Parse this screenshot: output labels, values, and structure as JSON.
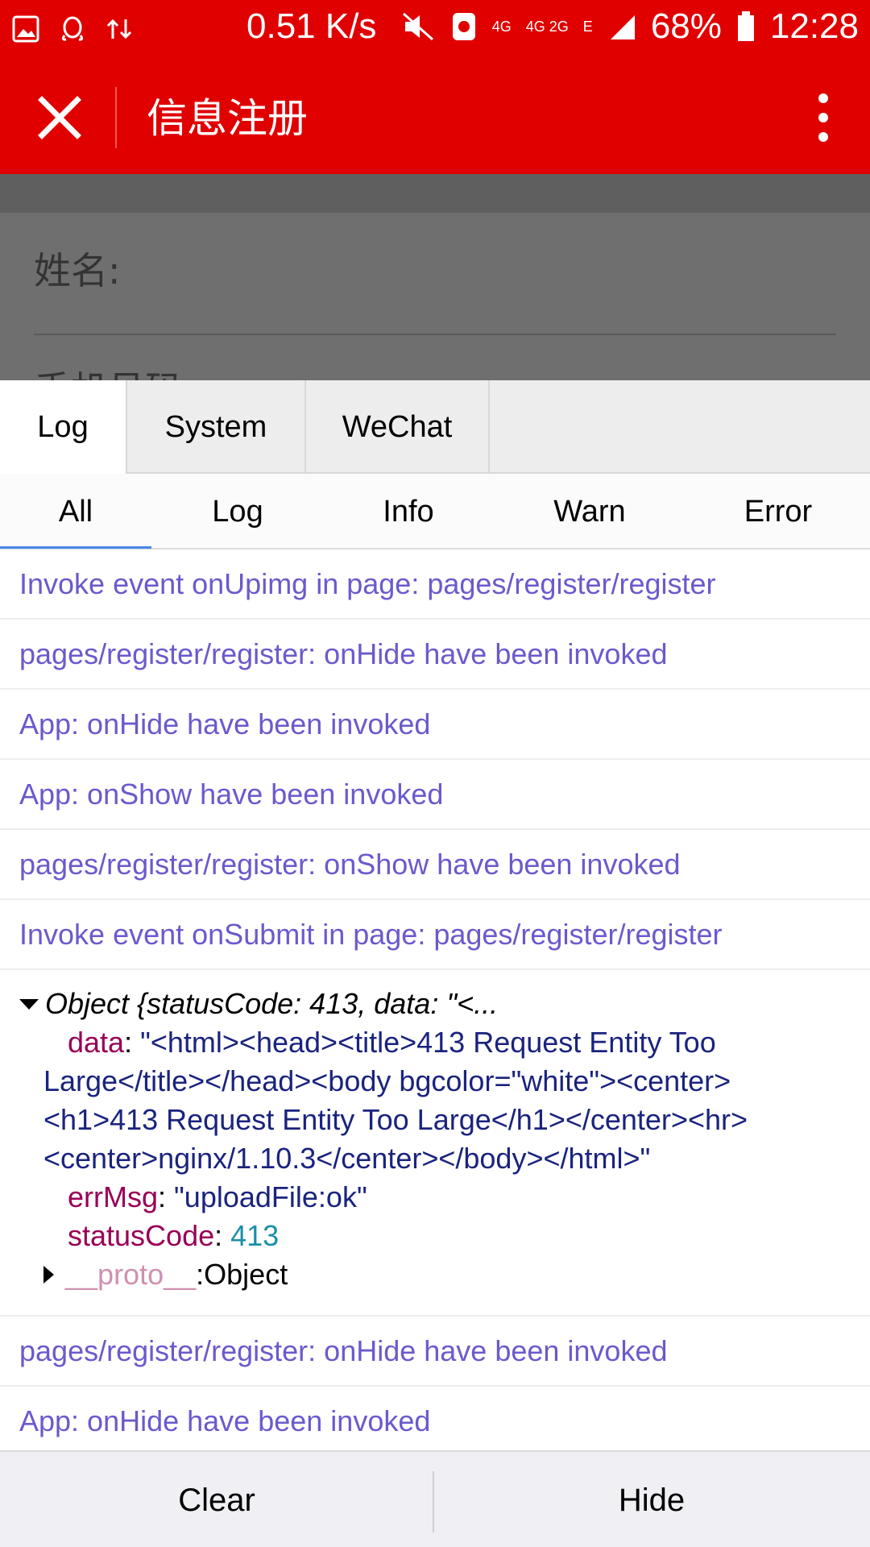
{
  "status_bar": {
    "speed": "0.51 K/s",
    "net_a": "4G",
    "net_b": "4G 2G",
    "net_c": "E",
    "battery": "68%",
    "time": "12:28"
  },
  "header": {
    "title": "信息注册"
  },
  "form": {
    "name_label": "姓名:",
    "phone_label": "手机号码"
  },
  "console": {
    "tabs": [
      "Log",
      "System",
      "WeChat"
    ],
    "subtabs": [
      "All",
      "Log",
      "Info",
      "Warn",
      "Error"
    ],
    "logs_before": [
      "Invoke event onUpimg in page: pages/register/register",
      "pages/register/register: onHide have been invoked",
      "App: onHide have been invoked",
      "App: onShow have been invoked",
      "pages/register/register: onShow have been invoked",
      "Invoke event onSubmit in page: pages/register/register"
    ],
    "object": {
      "summary": "Object {statusCode: 413, data: \"<...",
      "data_key": "data",
      "data_line1": "\"<html><head><title>413 Request Entity Too",
      "data_line2": "Large</title></head><body bgcolor=\"white\"><center>",
      "data_line3": "<h1>413 Request Entity Too Large</h1></center><hr>",
      "data_line4": "<center>nginx/1.10.3</center></body></html>\"",
      "errmsg_key": "errMsg",
      "errmsg_val": "\"uploadFile:ok\"",
      "status_key": "statusCode",
      "status_val": "413",
      "proto_key": "__proto__",
      "proto_val": "Object"
    },
    "logs_after": [
      "pages/register/register: onHide have been invoked",
      "App: onHide have been invoked"
    ],
    "footer": {
      "clear": "Clear",
      "hide": "Hide"
    }
  },
  "colors": {
    "brand_red": "#e00000",
    "log_text": "#6a5acd",
    "tab_underline": "#4a86e8"
  }
}
